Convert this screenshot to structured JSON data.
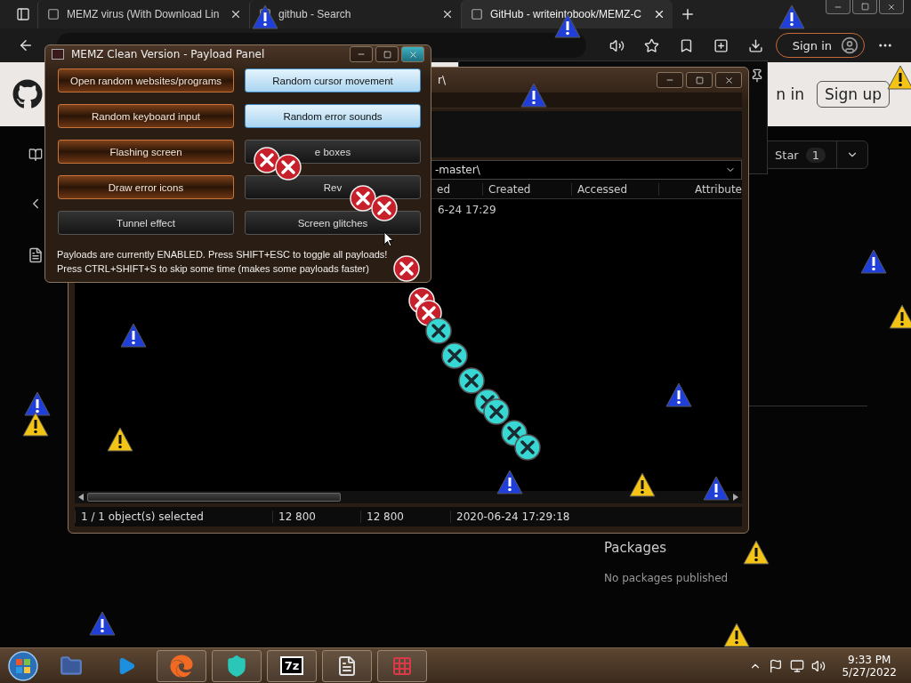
{
  "browser": {
    "tabs": [
      {
        "title": "MEMZ virus (With Download Lin",
        "selected": false
      },
      {
        "title": "github - Search",
        "selected": false
      },
      {
        "title": "GitHub - writeintobook/MEMZ-C",
        "selected": true
      }
    ],
    "sign_in": "Sign in"
  },
  "github": {
    "sign_in": "n in",
    "sign_up": "Sign up",
    "star": "Star",
    "star_count": "1",
    "packages_title": "Packages",
    "packages_text": "No packages published"
  },
  "explorer": {
    "title": "r\\",
    "path": "-master\\",
    "columns": [
      "ed",
      "Created",
      "Accessed",
      "Attribute"
    ],
    "rows": [
      [
        "6-24 17:29"
      ]
    ],
    "status": [
      "1 / 1 object(s) selected",
      "12 800",
      "12 800",
      "2020-06-24 17:29:18"
    ]
  },
  "panel": {
    "title": "MEMZ Clean Version - Payload Panel",
    "payloads": [
      {
        "label": "Open random websites/programs",
        "on": true,
        "highlighted": false
      },
      {
        "label": "Random cursor movement",
        "on": false,
        "highlighted": true
      },
      {
        "label": "Random keyboard input",
        "on": true,
        "highlighted": false
      },
      {
        "label": "Random error sounds",
        "on": false,
        "highlighted": true
      },
      {
        "label": "Flashing screen",
        "on": true,
        "highlighted": false
      },
      {
        "label": "e boxes",
        "on": false,
        "highlighted": false
      },
      {
        "label": "Draw error icons",
        "on": true,
        "highlighted": false
      },
      {
        "label": "Rev",
        "on": false,
        "highlighted": false
      },
      {
        "label": "Tunnel effect",
        "on": false,
        "highlighted": false
      },
      {
        "label": "Screen glitches",
        "on": false,
        "highlighted": false
      }
    ],
    "status_lines": [
      "Payloads are currently ENABLED. Press SHIFT+ESC to toggle all payloads!",
      "Press CTRL+SHIFT+S to skip some time (makes some payloads faster)"
    ]
  },
  "taskbar": {
    "archive_label": "7z",
    "time": "9:33 PM",
    "date": "5/27/2022"
  }
}
